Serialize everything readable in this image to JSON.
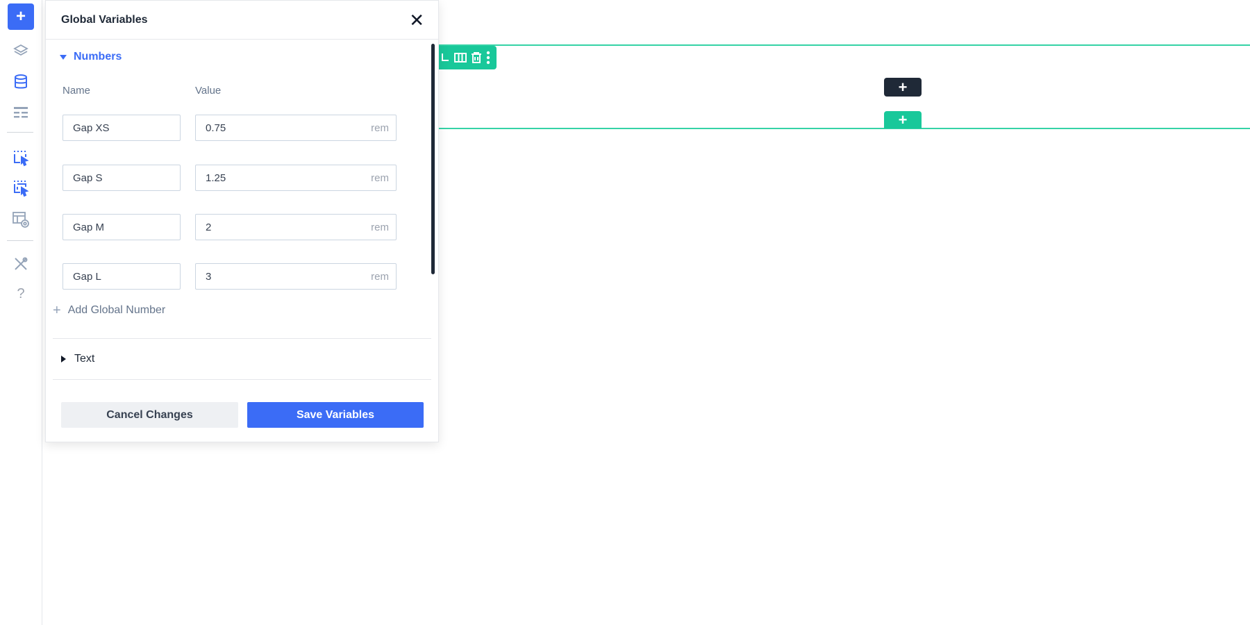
{
  "toolbar": {
    "icons": [
      "add-icon",
      "layers-icon",
      "database-icon",
      "layout-rows-icon",
      "select-element-icon",
      "select-multiple-icon",
      "template-preview-icon",
      "tools-icon",
      "help-icon"
    ],
    "add_label": "+",
    "help_label": "?"
  },
  "panel": {
    "title": "Global Variables",
    "close_label": "✕",
    "numbers_section": {
      "label": "Numbers",
      "expanded": true,
      "col_name": "Name",
      "col_value": "Value",
      "rows": [
        {
          "name": "Gap XS",
          "value": "0.75",
          "unit": "rem"
        },
        {
          "name": "Gap S",
          "value": "1.25",
          "unit": "rem"
        },
        {
          "name": "Gap M",
          "value": "2",
          "unit": "rem"
        },
        {
          "name": "Gap L",
          "value": "3",
          "unit": "rem"
        }
      ],
      "add_label": "Add Global Number"
    },
    "text_section": {
      "label": "Text",
      "expanded": false
    },
    "cancel_label": "Cancel Changes",
    "save_label": "Save Variables"
  },
  "canvas": {
    "add_block_label": "+",
    "add_section_label": "+"
  },
  "colors": {
    "accent": "#3b6cf6",
    "section_green": "#19c89a",
    "dark": "#1f2937"
  }
}
